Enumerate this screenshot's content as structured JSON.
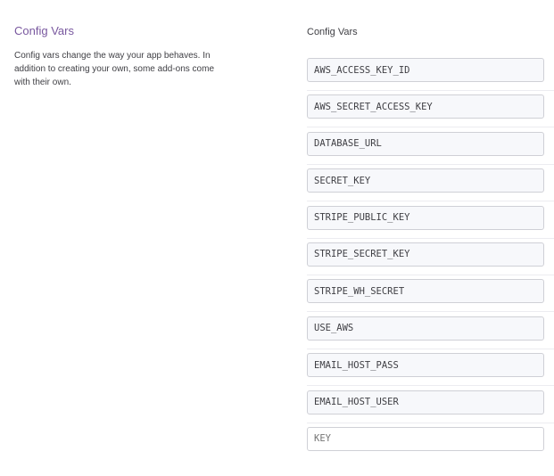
{
  "section": {
    "title": "Config Vars",
    "description": "Config vars change the way your app behaves. In addition to creating your own, some add-ons come with their own."
  },
  "config_vars": {
    "heading": "Config Vars",
    "keys": [
      "AWS_ACCESS_KEY_ID",
      "AWS_SECRET_ACCESS_KEY",
      "DATABASE_URL",
      "SECRET_KEY",
      "STRIPE_PUBLIC_KEY",
      "STRIPE_SECRET_KEY",
      "STRIPE_WH_SECRET",
      "USE_AWS",
      "EMAIL_HOST_PASS",
      "EMAIL_HOST_USER"
    ],
    "new_key_placeholder": "KEY"
  },
  "colors": {
    "accent": "#79589f",
    "text": "#3f3f44",
    "input_border": "#cfd0d6",
    "input_background": "#f7f8fb",
    "divider": "#ececf0"
  }
}
